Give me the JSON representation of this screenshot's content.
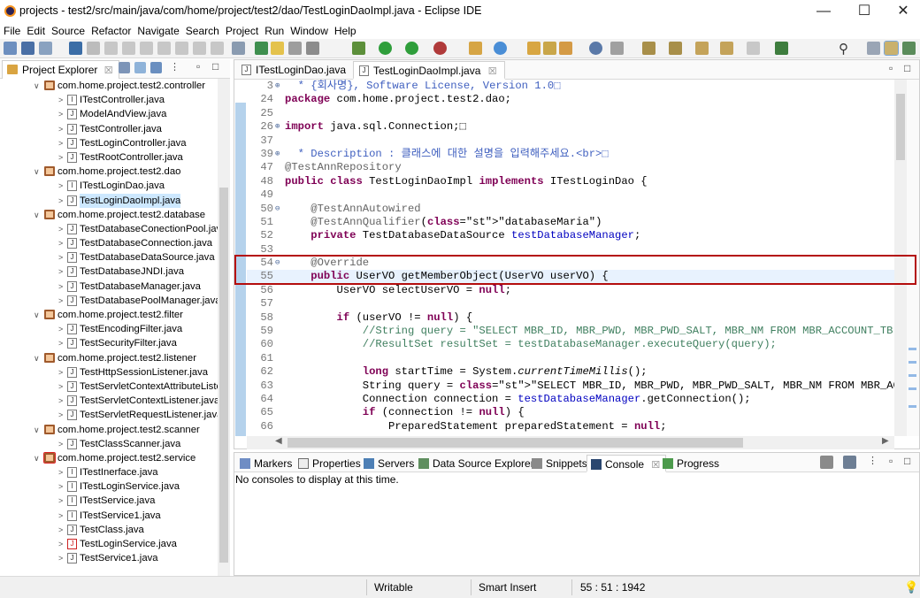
{
  "window": {
    "title": "projects - test2/src/main/java/com/home/project/test2/dao/TestLoginDaoImpl.java - Eclipse IDE",
    "min": "—",
    "max": "☐",
    "close": "✕"
  },
  "menu": [
    "File",
    "Edit",
    "Source",
    "Refactor",
    "Navigate",
    "Search",
    "Project",
    "Run",
    "Window",
    "Help"
  ],
  "project_explorer": {
    "tab_label": "Project Explorer",
    "tab_close": "☒",
    "items": [
      {
        "label": "com.home.project.test2.controller",
        "kind": "package"
      },
      {
        "label": "ITestController.java",
        "kind": "interface"
      },
      {
        "label": "ModelAndView.java",
        "kind": "class"
      },
      {
        "label": "TestController.java",
        "kind": "class"
      },
      {
        "label": "TestLoginController.java",
        "kind": "class"
      },
      {
        "label": "TestRootController.java",
        "kind": "class"
      },
      {
        "label": "com.home.project.test2.dao",
        "kind": "package"
      },
      {
        "label": "ITestLoginDao.java",
        "kind": "interface"
      },
      {
        "label": "TestLoginDaoImpl.java",
        "kind": "class",
        "selected": true
      },
      {
        "label": "com.home.project.test2.database",
        "kind": "package"
      },
      {
        "label": "TestDatabaseConectionPool.java",
        "kind": "class"
      },
      {
        "label": "TestDatabaseConnection.java",
        "kind": "class"
      },
      {
        "label": "TestDatabaseDataSource.java",
        "kind": "class"
      },
      {
        "label": "TestDatabaseJNDI.java",
        "kind": "class"
      },
      {
        "label": "TestDatabaseManager.java",
        "kind": "class"
      },
      {
        "label": "TestDatabasePoolManager.java",
        "kind": "class"
      },
      {
        "label": "com.home.project.test2.filter",
        "kind": "package"
      },
      {
        "label": "TestEncodingFilter.java",
        "kind": "class"
      },
      {
        "label": "TestSecurityFilter.java",
        "kind": "class"
      },
      {
        "label": "com.home.project.test2.listener",
        "kind": "package"
      },
      {
        "label": "TestHttpSessionListener.java",
        "kind": "class"
      },
      {
        "label": "TestServletContextAttributeListe",
        "kind": "class"
      },
      {
        "label": "TestServletContextListener.java",
        "kind": "class"
      },
      {
        "label": "TestServletRequestListener.java",
        "kind": "class"
      },
      {
        "label": "com.home.project.test2.scanner",
        "kind": "package"
      },
      {
        "label": "TestClassScanner.java",
        "kind": "class"
      },
      {
        "label": "com.home.project.test2.service",
        "kind": "package-error"
      },
      {
        "label": "ITestInerface.java",
        "kind": "interface"
      },
      {
        "label": "ITestLoginService.java",
        "kind": "interface"
      },
      {
        "label": "ITestService.java",
        "kind": "interface"
      },
      {
        "label": "ITestService1.java",
        "kind": "interface"
      },
      {
        "label": "TestClass.java",
        "kind": "class"
      },
      {
        "label": "TestLoginService.java",
        "kind": "class-error"
      },
      {
        "label": "TestService1.java",
        "kind": "class"
      }
    ]
  },
  "editor": {
    "tabs": [
      {
        "label": "ITestLoginDao.java",
        "active": false
      },
      {
        "label": "TestLoginDaoImpl.java",
        "active": true,
        "close": "☒"
      }
    ],
    "lines": [
      {
        "n": "3",
        "fold": "⊕",
        "text": "  * {회사명}, Software License, Version 1.0⬚",
        "cls": "jd"
      },
      {
        "n": "24",
        "text": "package com.home.project.test2.dao;",
        "cls": "pkg"
      },
      {
        "n": "25",
        "text": "",
        "cls": ""
      },
      {
        "n": "26",
        "fold": "⊕",
        "text": "import java.sql.Connection;⬚",
        "cls": "imp"
      },
      {
        "n": "37",
        "text": "",
        "cls": ""
      },
      {
        "n": "39",
        "fold": "⊕",
        "text": "  * Description : 클래스에 대한 설명을 입력해주세요.<br>⬚",
        "cls": "jd"
      },
      {
        "n": "47",
        "text": "@TestAnnRepository",
        "cls": "an"
      },
      {
        "n": "48",
        "text": "public class TestLoginDaoImpl implements ITestLoginDao {",
        "cls": "cls"
      },
      {
        "n": "49",
        "text": "",
        "cls": ""
      },
      {
        "n": "50",
        "fold": "⊖",
        "text": "    @TestAnnAutowired",
        "cls": "an"
      },
      {
        "n": "51",
        "text": "    @TestAnnQualifier(\"databaseMaria\")",
        "cls": "anq"
      },
      {
        "n": "52",
        "text": "    private TestDatabaseDataSource testDatabaseManager;",
        "cls": "fld"
      },
      {
        "n": "53",
        "text": "",
        "cls": ""
      },
      {
        "n": "54",
        "fold": "⊖",
        "text": "    @Override",
        "cls": "an"
      },
      {
        "n": "55",
        "text": "    public UserVO getMemberObject(UserVO userVO) {",
        "cls": "sig",
        "cur": true
      },
      {
        "n": "56",
        "text": "        UserVO selectUserVO = null;",
        "cls": "nul"
      },
      {
        "n": "57",
        "text": "",
        "cls": ""
      },
      {
        "n": "58",
        "text": "        if (userVO != null) {",
        "cls": "if"
      },
      {
        "n": "59",
        "text": "            //String query = \"SELECT MBR_ID, MBR_PWD, MBR_PWD_SALT, MBR_NM FROM MBR_ACCOUNT_TB WHERE MBR_",
        "cls": "cm"
      },
      {
        "n": "60",
        "text": "            //ResultSet resultSet = testDatabaseManager.executeQuery(query);",
        "cls": "cm"
      },
      {
        "n": "61",
        "text": "",
        "cls": ""
      },
      {
        "n": "62",
        "text": "            long startTime = System.currentTimeMillis();",
        "cls": "long"
      },
      {
        "n": "63",
        "text": "            String query = \"SELECT MBR_ID, MBR_PWD, MBR_PWD_SALT, MBR_NM FROM MBR_ACCOUNT_TB WHERE MBR_ID",
        "cls": "q"
      },
      {
        "n": "64",
        "text": "            Connection connection = testDatabaseManager.getConnection();",
        "cls": "conn"
      },
      {
        "n": "65",
        "text": "            if (connection != null) {",
        "cls": "if2"
      },
      {
        "n": "66",
        "text": "                PreparedStatement preparedStatement = null;",
        "cls": "ps"
      }
    ]
  },
  "console": {
    "tabs": [
      "Markers",
      "Properties",
      "Servers",
      "Data Source Explorer",
      "Snippets",
      "Console",
      "Progress"
    ],
    "active_tab": "Console",
    "message": "No consoles to display at this time."
  },
  "status": {
    "writable": "Writable",
    "insert_mode": "Smart Insert",
    "position": "55 : 51 : 1942"
  },
  "colors": {
    "highlight_box": "#b40d0d",
    "selection": "#cde8ff",
    "current_line": "#e8f2fe"
  }
}
